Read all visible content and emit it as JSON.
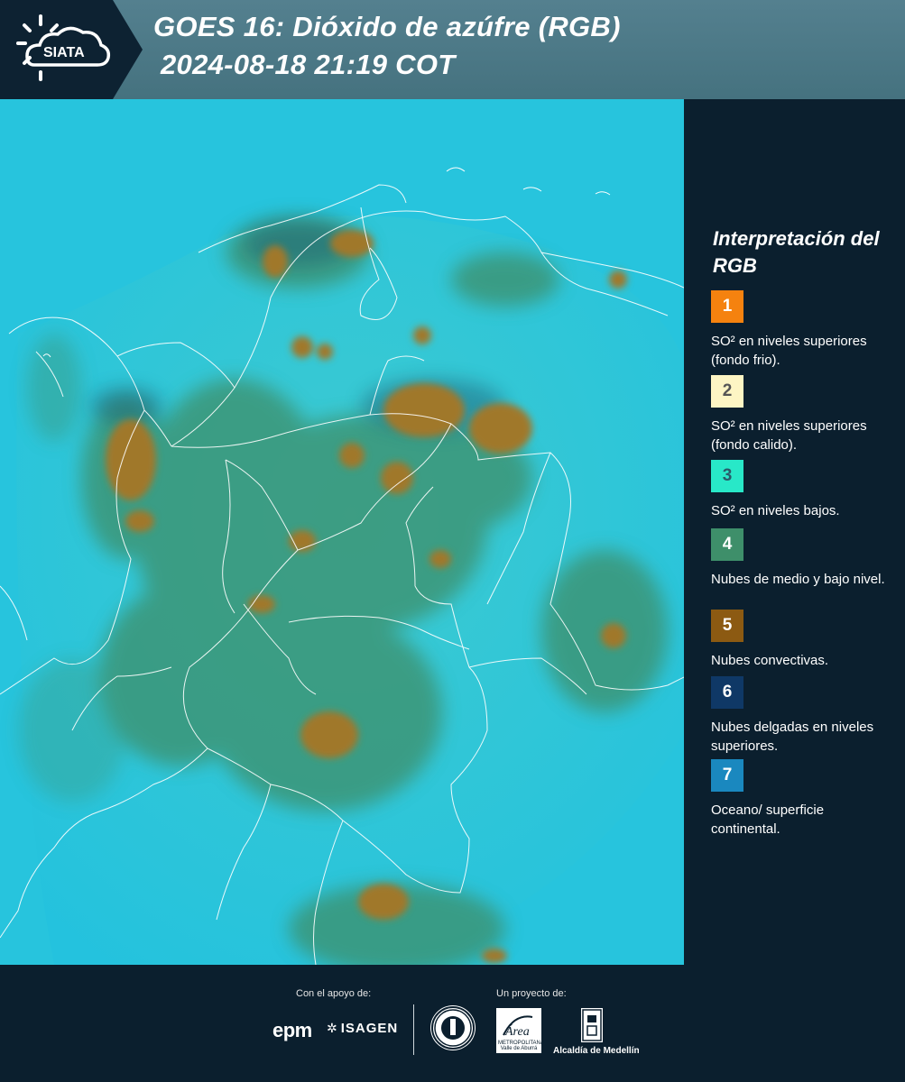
{
  "header": {
    "logo_text": "SIATA",
    "title_line1": "GOES 16: Dióxido de azúfre (RGB)",
    "title_line2": "2024-08-18 21:19 COT"
  },
  "legend": {
    "title": "Interpretación del RGB",
    "items": [
      {
        "number": "1",
        "text": "SO² en niveles superiores (fondo frio).",
        "color": "#f5820f",
        "num_color": "#ffffff"
      },
      {
        "number": "2",
        "text": "SO² en niveles superiores (fondo calido).",
        "color": "#fdf5c4",
        "num_color": "#555555"
      },
      {
        "number": "3",
        "text": "SO² en niveles bajos.",
        "color": "#28e8c8",
        "num_color": "#2a5a6a"
      },
      {
        "number": "4",
        "text": "Nubes de medio y bajo nivel.",
        "color": "#3e8f6a",
        "num_color": "#ffffff"
      },
      {
        "number": "5",
        "text": "Nubes convectivas.",
        "color": "#8c5a12",
        "num_color": "#ffffff"
      },
      {
        "number": "6",
        "text": "Nubes delgadas en niveles superiores.",
        "color": "#0f3866",
        "num_color": "#ffffff"
      },
      {
        "number": "7",
        "text": "Oceano/ superficie continental.",
        "color": "#1a88bf",
        "num_color": "#ffffff"
      }
    ]
  },
  "footer": {
    "support_label": "Con el apoyo de:",
    "project_label": "Un proyecto de:",
    "sponsors": [
      "epm",
      "ISAGEN"
    ],
    "partners": [
      "Área Metropolitana",
      "Alcaldía de Medellín"
    ],
    "area_caption": "METROPOLITANA Valle de Aburrá",
    "alcaldia_label": "Alcaldía de Medellín"
  },
  "map": {
    "ocean_color": "#27c4dd",
    "cloud_mid_color": "#3e8f6a",
    "cloud_convective_color": "#a0782a",
    "border_color": "#ffffff"
  }
}
